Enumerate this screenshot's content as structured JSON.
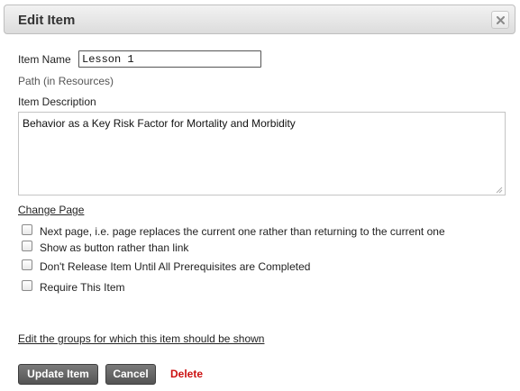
{
  "dialog": {
    "title": "Edit Item",
    "close_icon": "close-icon"
  },
  "form": {
    "item_name_label": "Item Name",
    "item_name_value": "Lesson 1",
    "path_label": "Path (in Resources)",
    "description_label": "Item Description",
    "description_value": "Behavior as a Key Risk Factor for Mortality and Morbidity",
    "change_page_link": "Change Page",
    "options": [
      {
        "label": "Next page, i.e. page replaces the current one rather than returning to the current one",
        "checked": false
      },
      {
        "label": "Show as button rather than link",
        "checked": false
      },
      {
        "label": "Don't Release Item Until All Prerequisites are Completed",
        "checked": false
      },
      {
        "label": "Require This Item",
        "checked": false
      }
    ],
    "groups_link": "Edit the groups for which this item should be shown"
  },
  "actions": {
    "update_label": "Update Item",
    "cancel_label": "Cancel",
    "delete_label": "Delete"
  },
  "colors": {
    "button_bg": "#5f5f5f",
    "delete_text": "#cc1111",
    "titlebar_bg": "#e6e6e6"
  }
}
